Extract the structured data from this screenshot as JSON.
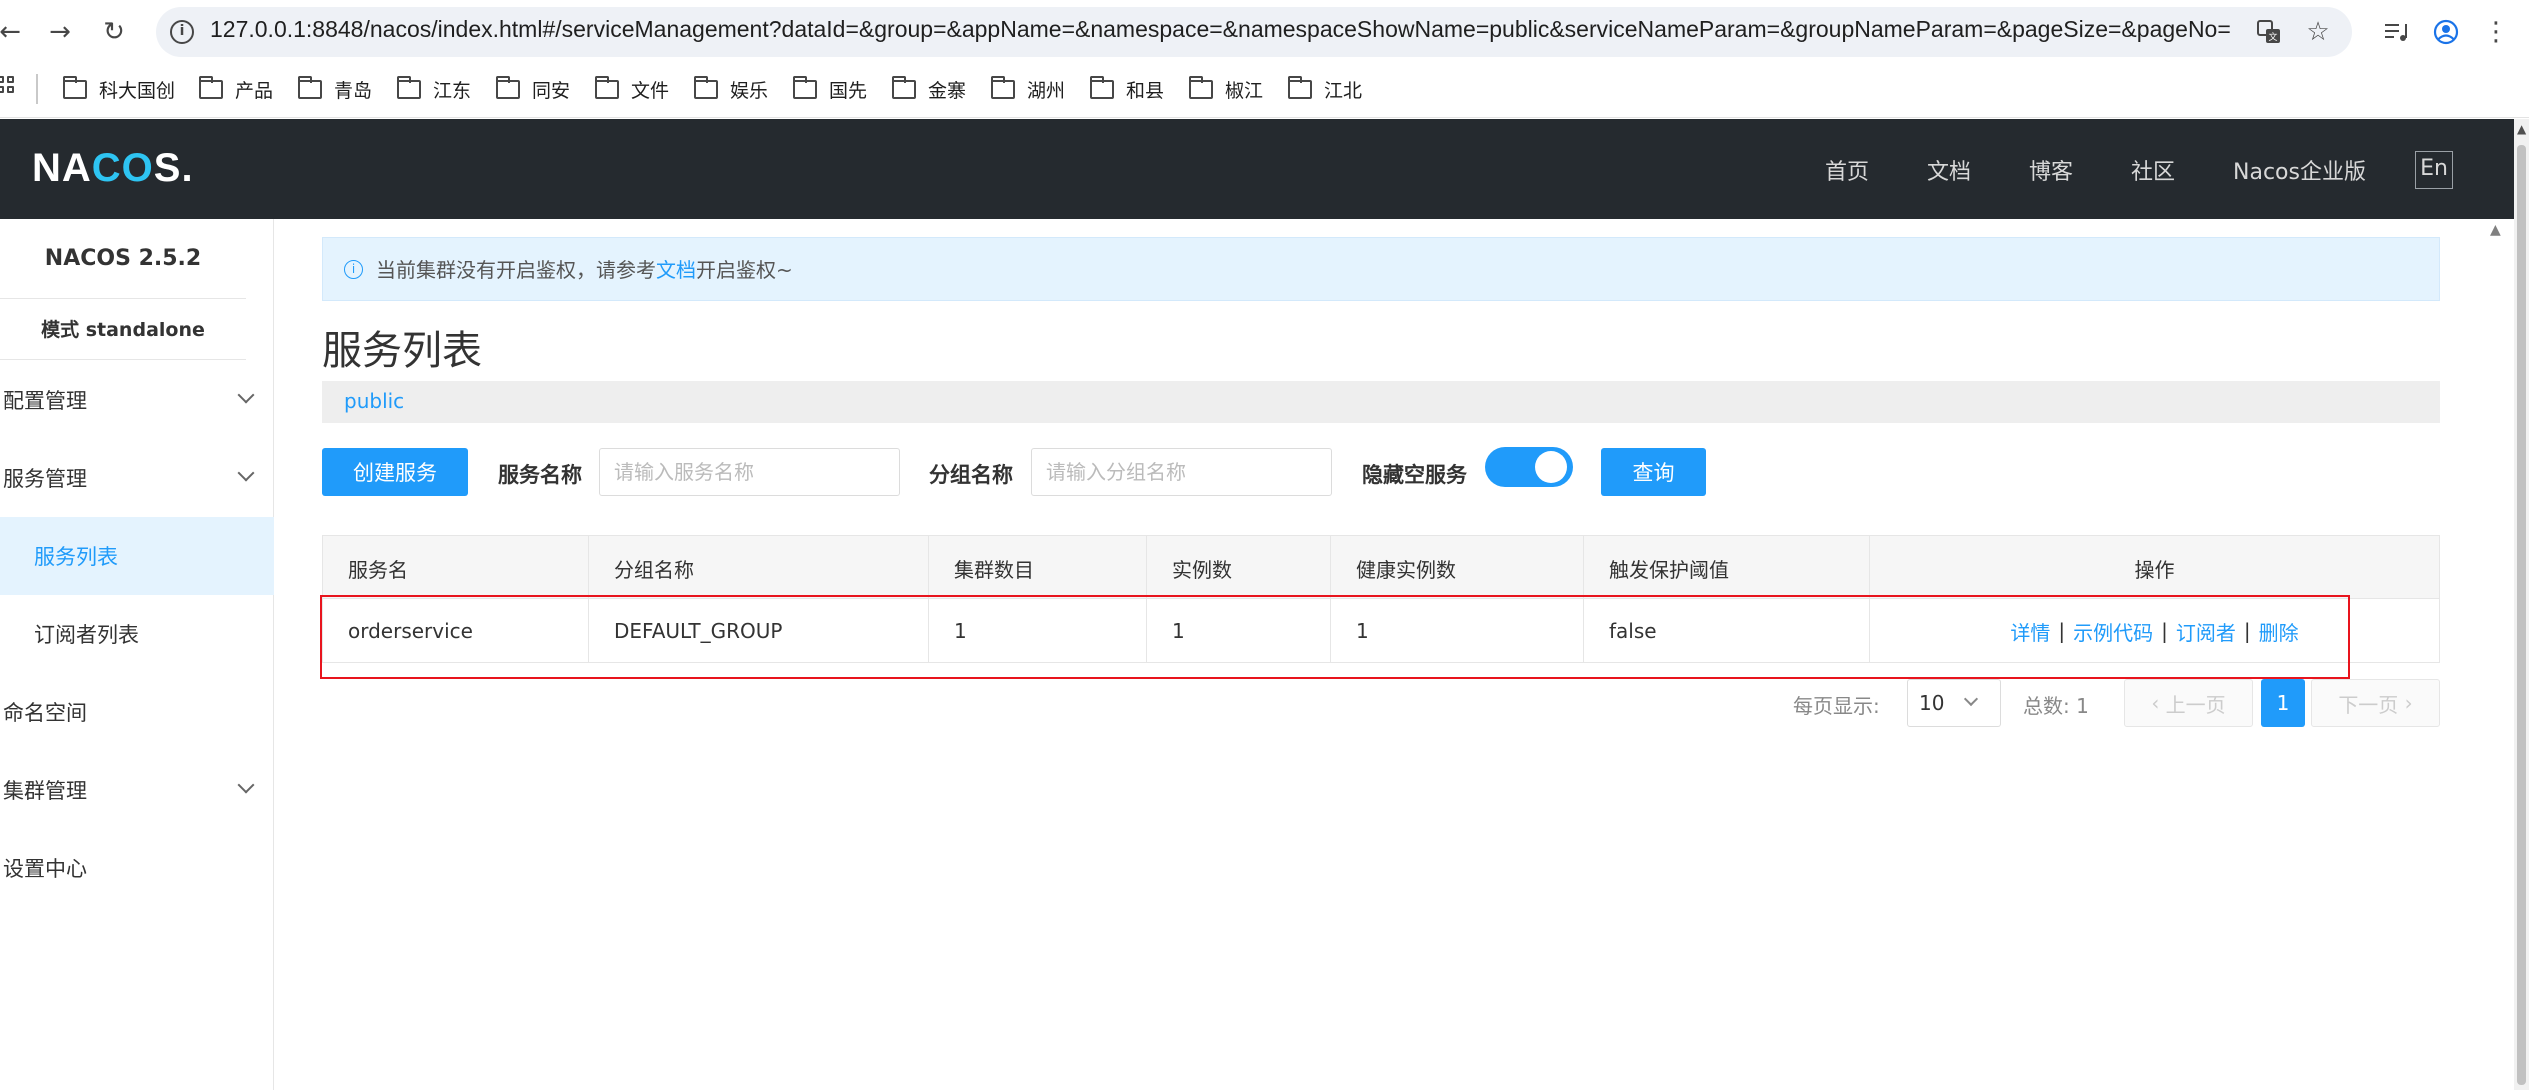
{
  "browser": {
    "url": "127.0.0.1:8848/nacos/index.html#/serviceManagement?dataId=&group=&appName=&namespace=&namespaceShowName=public&serviceNameParam=&groupNameParam=&pageSize=&pageNo=",
    "bookmarks": [
      "科大国创",
      "产品",
      "青岛",
      "江东",
      "同安",
      "文件",
      "娱乐",
      "国先",
      "金寨",
      "湖州",
      "和县",
      "椒江",
      "江北"
    ]
  },
  "header": {
    "logo_left": "NA",
    "logo_mid": "CO",
    "logo_right": "S.",
    "nav": [
      "首页",
      "文档",
      "博客",
      "社区",
      "Nacos企业版"
    ],
    "lang": "En"
  },
  "sidebar": {
    "version": "NACOS 2.5.2",
    "mode": "模式 standalone",
    "items": [
      {
        "label": "配置管理",
        "expandable": true
      },
      {
        "label": "服务管理",
        "expandable": true
      },
      {
        "label": "服务列表",
        "sub": true,
        "active": true
      },
      {
        "label": "订阅者列表",
        "sub": true
      },
      {
        "label": "命名空间"
      },
      {
        "label": "集群管理",
        "expandable": true
      },
      {
        "label": "设置中心"
      }
    ]
  },
  "notice": {
    "text_before": "当前集群没有开启鉴权，请参考",
    "link": "文档",
    "text_after": "开启鉴权~"
  },
  "page": {
    "title": "服务列表",
    "namespace": "public"
  },
  "toolbar": {
    "create_label": "创建服务",
    "service_name_label": "服务名称",
    "service_name_placeholder": "请输入服务名称",
    "group_name_label": "分组名称",
    "group_name_placeholder": "请输入分组名称",
    "hide_empty_label": "隐藏空服务",
    "hide_empty_on": true,
    "query_label": "查询"
  },
  "table": {
    "headers": [
      "服务名",
      "分组名称",
      "集群数目",
      "实例数",
      "健康实例数",
      "触发保护阈值",
      "操作"
    ],
    "rows": [
      {
        "service_name": "orderservice",
        "group": "DEFAULT_GROUP",
        "clusters": "1",
        "instances": "1",
        "healthy": "1",
        "protect_threshold": "false",
        "actions": [
          "详情",
          "示例代码",
          "订阅者",
          "删除"
        ]
      }
    ]
  },
  "pagination": {
    "page_size_label": "每页显示:",
    "page_size": "10",
    "total": "总数: 1",
    "prev": "上一页",
    "current": "1",
    "next": "下一页"
  },
  "colors": {
    "accent": "#209bfa",
    "header_bg": "#252a2f",
    "highlight": "#e8141d"
  }
}
